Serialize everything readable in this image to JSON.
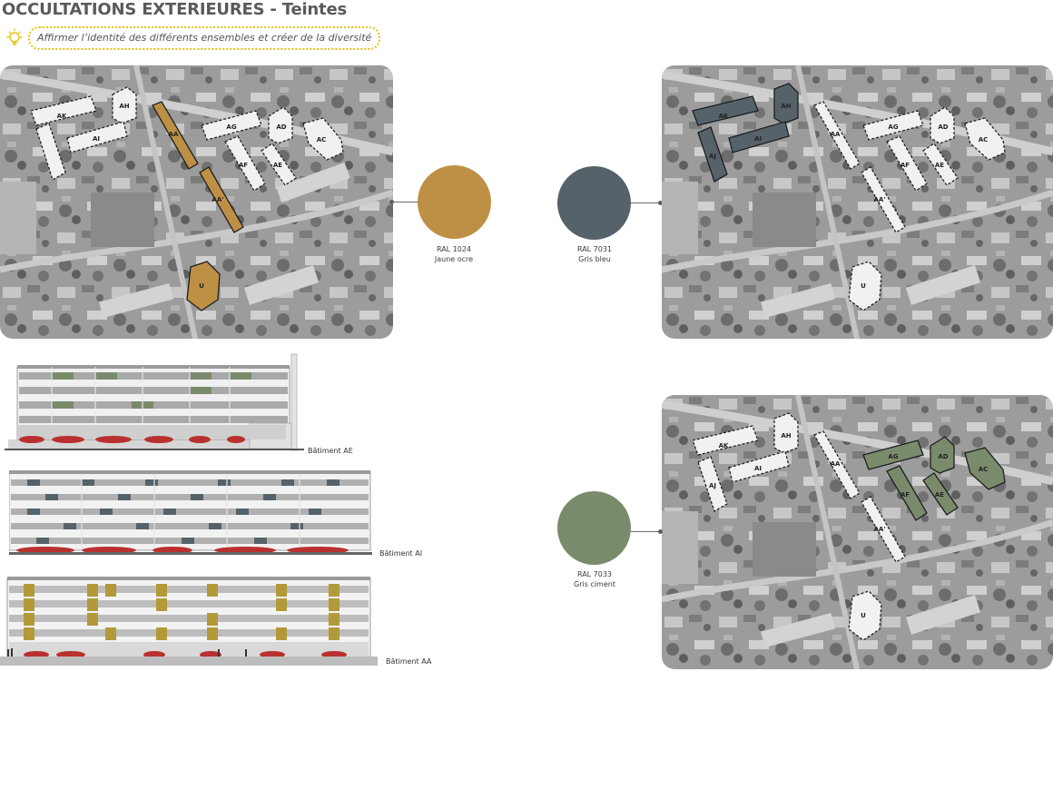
{
  "header": {
    "title": "OCCULTATIONS EXTERIEURES - Teintes",
    "subtitle": "Affirmer l’identité des différents ensembles et créer de la diversité",
    "icon": "lightbulb-icon"
  },
  "colors": [
    {
      "code": "RAL 1024",
      "name": "Jaune ocre",
      "hex": "#bd9045"
    },
    {
      "code": "RAL 7031",
      "name": "Gris bleu",
      "hex": "#56626a"
    },
    {
      "code": "RAL 7033",
      "name": "Gris ciment",
      "hex": "#7a8b6c"
    }
  ],
  "maps": {
    "ochre": {
      "buildings": [
        "AK",
        "AH",
        "AI",
        "AJ",
        "AA",
        "AA'",
        "U",
        "AG",
        "AD",
        "AC",
        "AF",
        "AE"
      ],
      "highlighted": [
        "AA",
        "AA'",
        "U"
      ]
    },
    "blue": {
      "buildings": [
        "AK",
        "AH",
        "AI",
        "AJ",
        "AA",
        "AA'",
        "U",
        "AG",
        "AD",
        "AC",
        "AF",
        "AE"
      ],
      "highlighted": [
        "AK",
        "AH",
        "AI",
        "AJ"
      ]
    },
    "green": {
      "buildings": [
        "AK",
        "AH",
        "AI",
        "AJ",
        "AA",
        "AA'",
        "U",
        "AG",
        "AD",
        "AC",
        "AF",
        "AE"
      ],
      "highlighted": [
        "AG",
        "AD",
        "AC",
        "AF",
        "AE"
      ]
    }
  },
  "facades": [
    {
      "label": "Bâtiment AE",
      "accent": "#7a8b6c"
    },
    {
      "label": "Bâtiment AI",
      "accent": "#56626a"
    },
    {
      "label": "Bâtiment AA",
      "accent": "#bd9045"
    }
  ]
}
